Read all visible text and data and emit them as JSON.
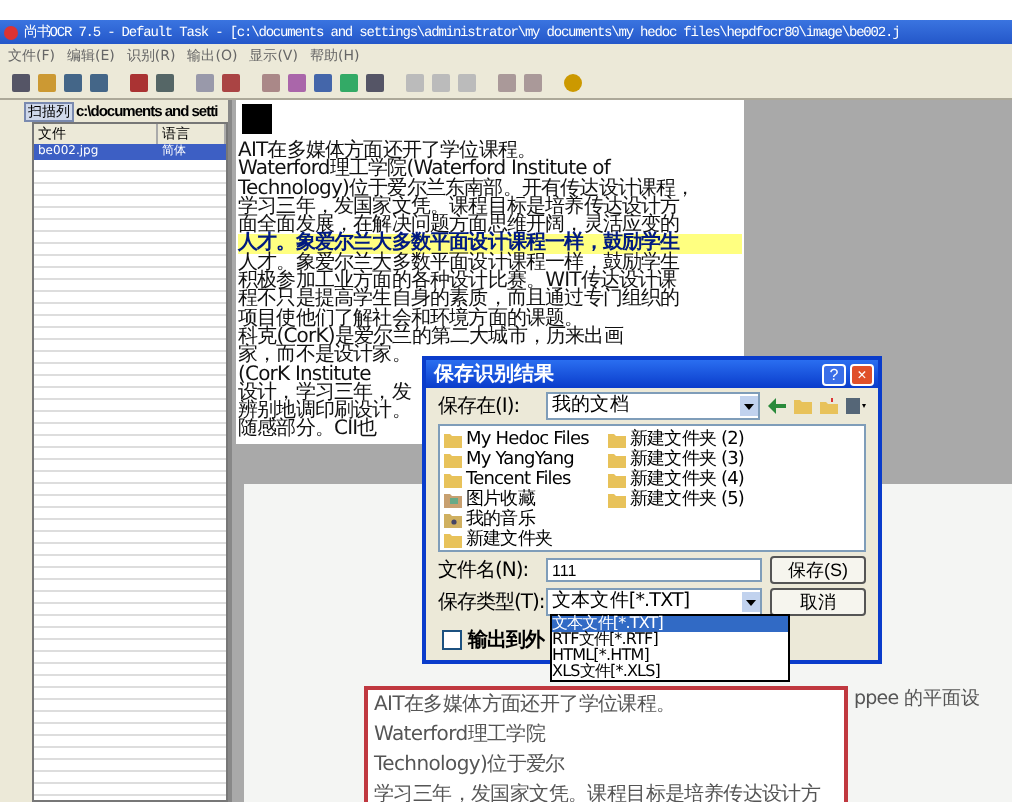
{
  "window": {
    "title": "尚书OCR 7.5 - Default Task - [c:\\documents and settings\\administrator\\my documents\\my hedoc files\\hepdfocr80\\image\\be002.j"
  },
  "menu": [
    "文件(F)",
    "编辑(E)",
    "识别(R)",
    "输出(O)",
    "显示(V)",
    "帮助(H)"
  ],
  "file_panel": {
    "tab": "扫描列",
    "path": "c:\\documents and setti",
    "columns": [
      "文件",
      "语言"
    ],
    "rows": [
      {
        "cells": [
          "be002.jpg",
          "简体"
        ],
        "selected": true
      }
    ]
  },
  "document": {
    "lines": [
      {
        "text": "AIT在多媒体方面还开了学位课程。",
        "highlighted": false
      },
      {
        "text": "Waterford理工学院(Waterford Institute of",
        "highlighted": false
      },
      {
        "text": "Technology)位于爱尔兰东南部。开有传达设计课程，",
        "highlighted": false
      },
      {
        "text": "学习三年，发国家文凭。课程目标是培养传达设计方",
        "highlighted": false
      },
      {
        "text": "面全面发展，在解决问题方面思维开阔，灵活应变的",
        "highlighted": false
      },
      {
        "text": "人才。象爱尔兰大多数平面设计课程一样，鼓励学生",
        "highlighted": true
      },
      {
        "text": "人才。象爱尔兰大多数平面设计课程一样，鼓励学生",
        "highlighted": false
      },
      {
        "text": "积极参加工业方面的各种设计比赛。WIT传达设计课",
        "highlighted": false
      },
      {
        "text": "程不只是提高学生自身的素质，而且通过专门组织的",
        "highlighted": false
      },
      {
        "text": "项目使他们了解社会和环境方面的课题。",
        "highlighted": false
      },
      {
        "text": "科克(CorK)是爱尔兰的第二大城市，历来出画",
        "highlighted": false
      },
      {
        "text": "家，而不是设计家。",
        "highlighted": false
      },
      {
        "text": "(CorK Institute",
        "highlighted": false
      },
      {
        "text": "设计，学习三年，发",
        "highlighted": false
      },
      {
        "text": "辨别地调印刷设计。",
        "highlighted": false
      },
      {
        "text": "随感部分。CII也",
        "highlighted": false
      }
    ]
  },
  "dialog": {
    "title": "保存识别结果",
    "help": "?",
    "close": "×",
    "save_in_label": "保存在(I):",
    "save_in_value": "我的文档",
    "items": [
      {
        "name": "My Hedoc Files",
        "kind": "folder"
      },
      {
        "name": "My YangYang",
        "kind": "folder"
      },
      {
        "name": "Tencent Files",
        "kind": "folder"
      },
      {
        "name": "图片收藏",
        "kind": "pictures"
      },
      {
        "name": "我的音乐",
        "kind": "music"
      },
      {
        "name": "新建文件夹",
        "kind": "folder"
      },
      {
        "name": "新建文件夹 (2)",
        "kind": "folder"
      },
      {
        "name": "新建文件夹 (3)",
        "kind": "folder"
      },
      {
        "name": "新建文件夹 (4)",
        "kind": "folder"
      },
      {
        "name": "新建文件夹 (5)",
        "kind": "folder"
      }
    ],
    "filename_label": "文件名(N):",
    "filename_value": "111",
    "type_label": "保存类型(T):",
    "type_value": "文本文件[*.TXT]",
    "type_options": [
      {
        "label": "文本文件[*.TXT]",
        "selected": true
      },
      {
        "label": "RTF文件[*.RTF]",
        "selected": false
      },
      {
        "label": "HTML[*.HTM]",
        "selected": false
      },
      {
        "label": "XLS文件[*.XLS]",
        "selected": false
      }
    ],
    "save_button": "保存(S)",
    "cancel_button": "取消",
    "output_checkbox": {
      "label": "输出到外",
      "checked": false
    }
  },
  "image_preview": {
    "lines": [
      "AIT在多媒体方面还开了学位课程。",
      "Waterford理工学院",
      "Technology)位于爱尔",
      "学习三年，发国家文凭。课程目标是培养传达设计方"
    ],
    "side_text": "ppee 的平面设"
  }
}
